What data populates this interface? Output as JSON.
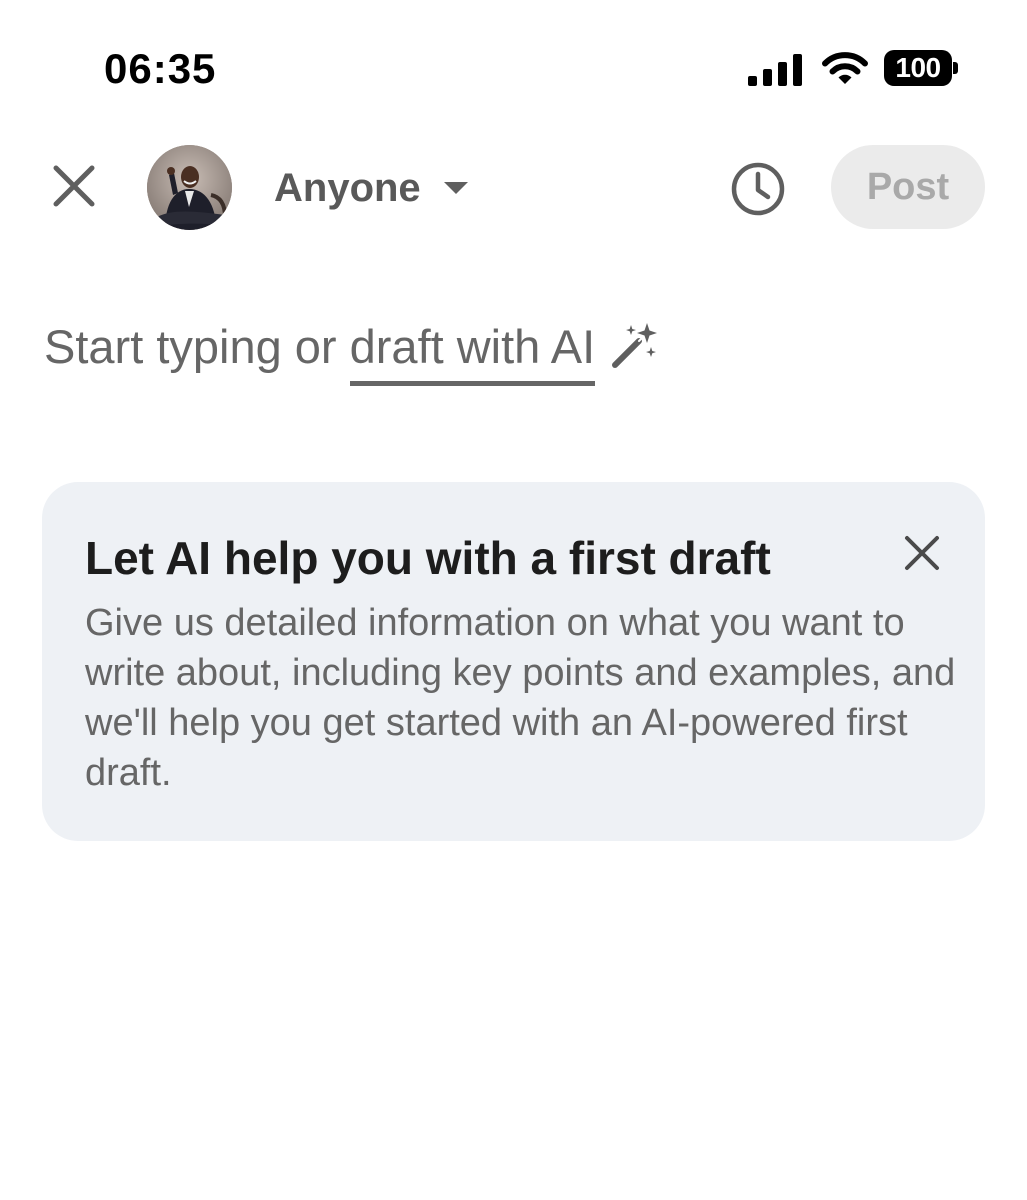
{
  "status_bar": {
    "time": "06:35",
    "battery_level": "100"
  },
  "header": {
    "audience_label": "Anyone",
    "post_label": "Post"
  },
  "composer": {
    "prefix": "Start typing or ",
    "ai_link": "draft with AI"
  },
  "ai_card": {
    "title": "Let AI help you with a first draft",
    "body": "Give us detailed information on what you want to write about, including key points and examples, and we'll help you get started with an AI-powered first draft."
  },
  "icons": {
    "close": "close-icon",
    "caret": "caret-down-icon",
    "schedule": "clock-icon",
    "magic": "magic-wand-icon"
  },
  "colors": {
    "card_background": "#eef1f5",
    "post_button_disabled": "#ebebeb",
    "secondary_text": "#666666"
  }
}
